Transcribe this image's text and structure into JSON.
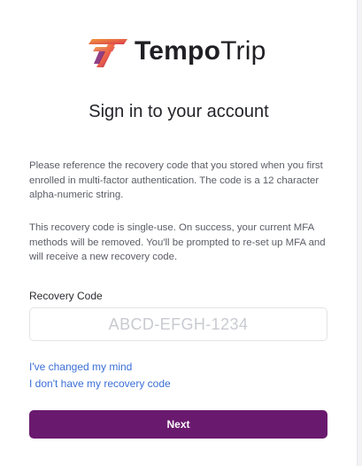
{
  "logo": {
    "brand_bold": "Tempo",
    "brand_light": "Trip",
    "icon": "tempotrip-logo-mark",
    "colors": {
      "orange": "#f39a3a",
      "red": "#e0455a",
      "purple": "#6a1a6e"
    }
  },
  "header": {
    "title": "Sign in to your account"
  },
  "instructions": {
    "paragraph_1": "Please reference the recovery code that you stored when you first enrolled in multi-factor authentication. The code is a 12 character alpha-numeric string.",
    "paragraph_2": "This recovery code is single-use. On success, your current MFA methods will be removed. You'll be prompted to re-set up MFA and will receive a new recovery code."
  },
  "form": {
    "recovery_label": "Recovery Code",
    "recovery_placeholder": "ABCD-EFGH-1234",
    "recovery_value": ""
  },
  "links": {
    "changed_mind": "I've changed my mind",
    "no_recovery_code": "I don't have my recovery code"
  },
  "actions": {
    "next_label": "Next",
    "accent_color": "#6a1a6e"
  }
}
